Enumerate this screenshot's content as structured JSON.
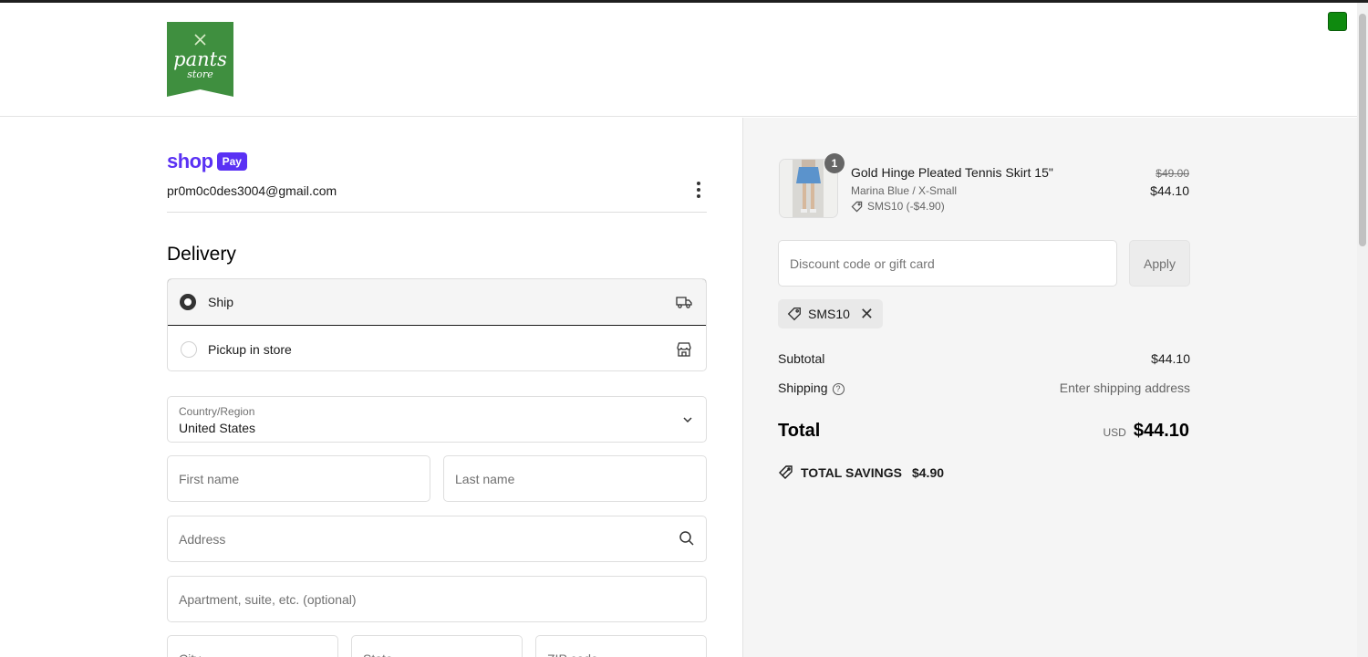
{
  "brand": {
    "logo_text": "pants",
    "logo_subtext": "store",
    "logo_color": "#3f8f3f"
  },
  "shop_pay": {
    "word": "shop",
    "badge": "Pay",
    "color": "#5a31f4",
    "email": "pr0m0c0des3004@gmail.com"
  },
  "delivery": {
    "title": "Delivery",
    "options": [
      {
        "label": "Ship",
        "selected": true,
        "icon": "truck-icon"
      },
      {
        "label": "Pickup in store",
        "selected": false,
        "icon": "store-icon"
      }
    ]
  },
  "form": {
    "country_label": "Country/Region",
    "country_value": "United States",
    "first_name_placeholder": "First name",
    "last_name_placeholder": "Last name",
    "address_placeholder": "Address",
    "apartment_placeholder": "Apartment, suite, etc. (optional)",
    "city_placeholder": "City",
    "state_placeholder": "State",
    "zip_placeholder": "ZIP code"
  },
  "summary": {
    "item": {
      "quantity": "1",
      "name": "Gold Hinge Pleated Tennis Skirt 15\"",
      "variant": "Marina Blue / X-Small",
      "discount": "SMS10 (-$4.90)",
      "price_original": "$49.00",
      "price_final": "$44.10"
    },
    "discount_placeholder": "Discount code or gift card",
    "apply_label": "Apply",
    "applied_code": "SMS10",
    "subtotal_label": "Subtotal",
    "subtotal_value": "$44.10",
    "shipping_label": "Shipping",
    "shipping_value": "Enter shipping address",
    "total_label": "Total",
    "total_currency": "USD",
    "total_value": "$44.10",
    "savings_label": "TOTAL SAVINGS",
    "savings_value": "$4.90"
  }
}
